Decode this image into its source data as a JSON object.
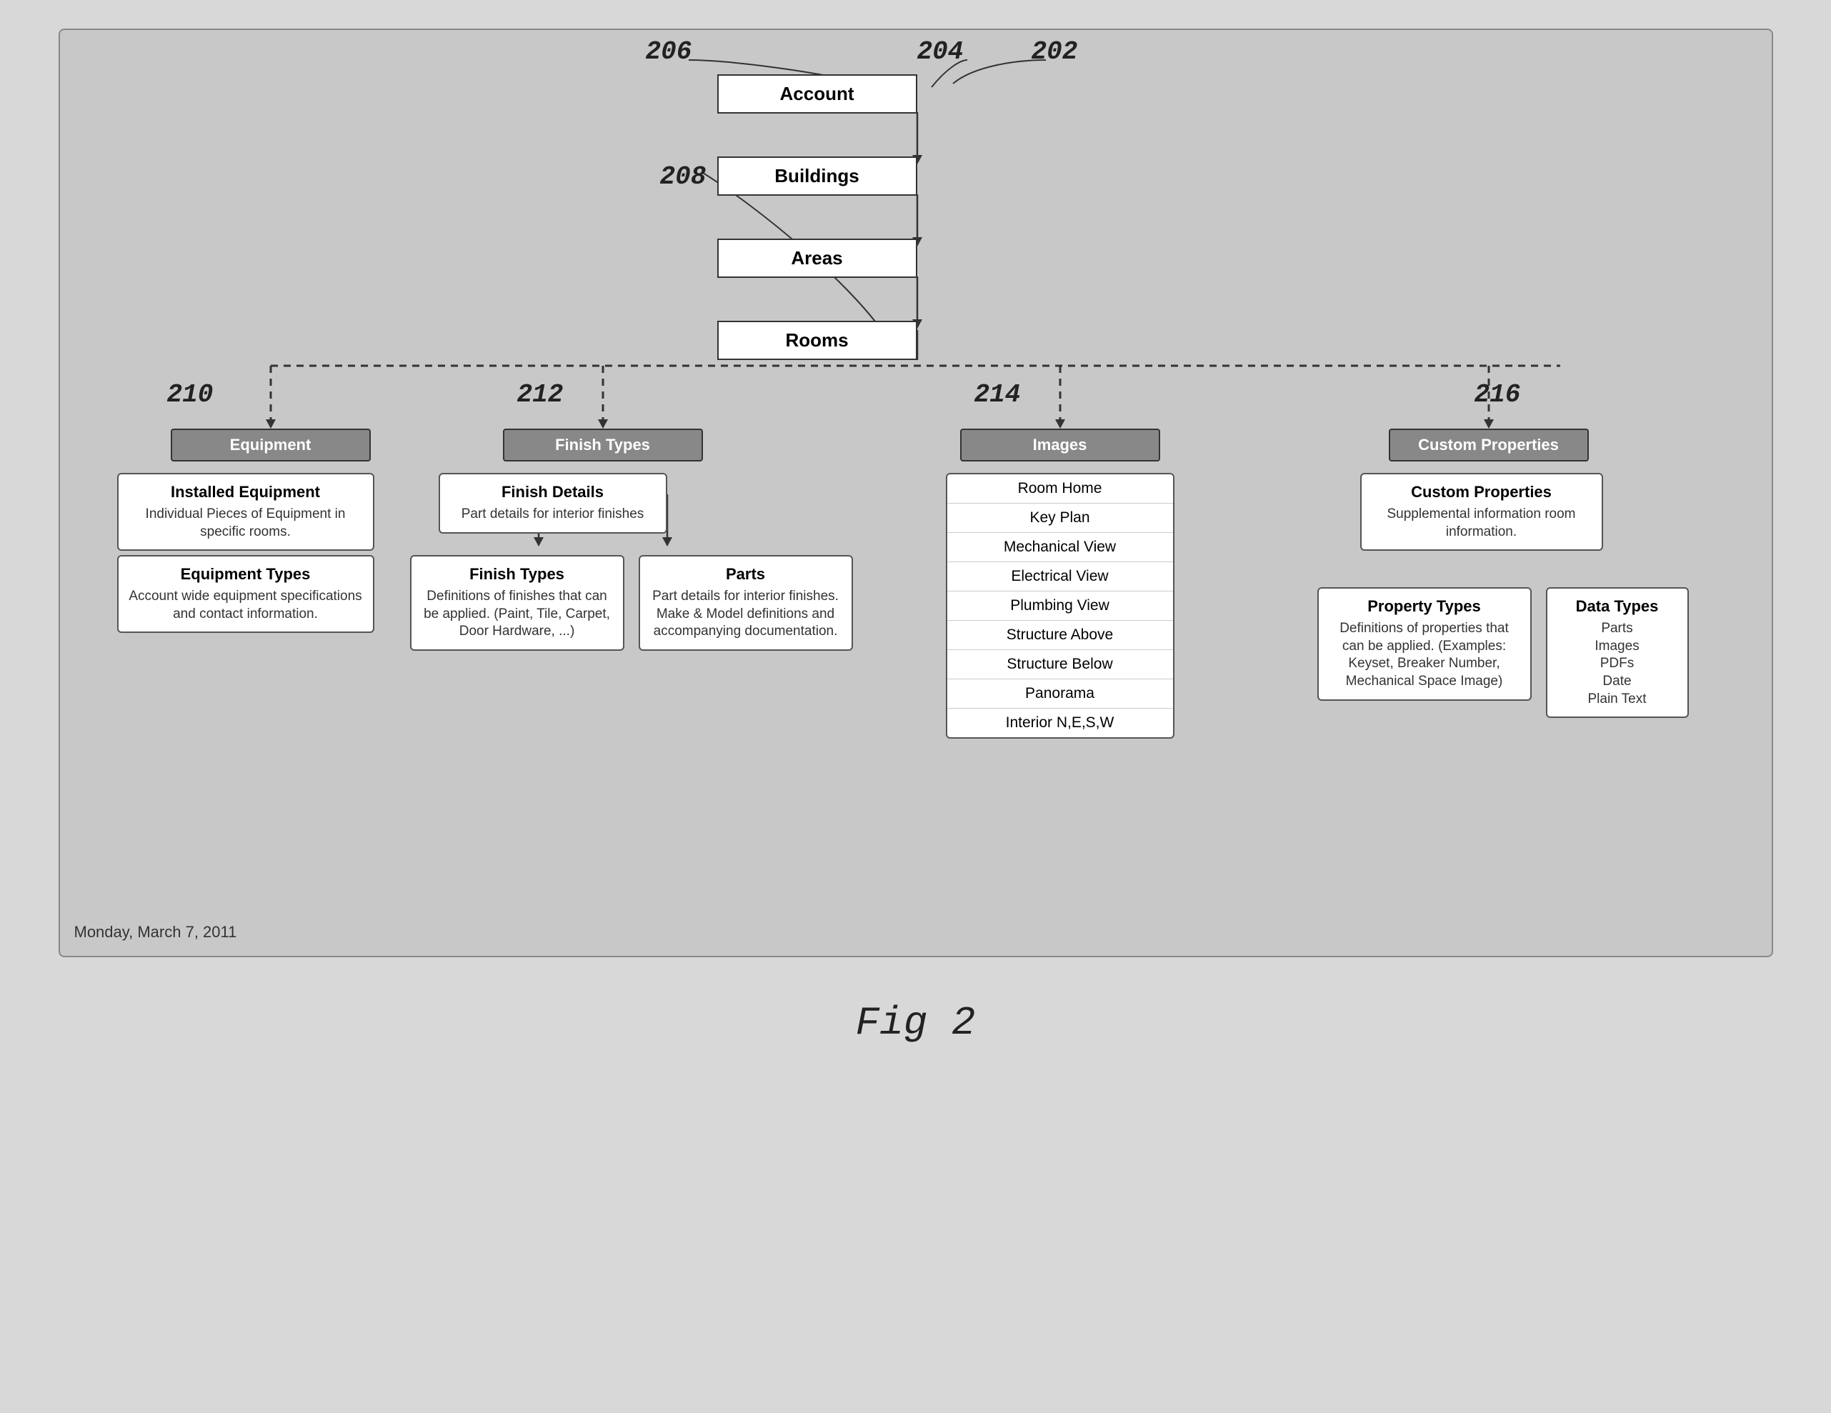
{
  "diagram": {
    "title": "Fig 2",
    "date": "Monday, March 7, 2011",
    "ref_numbers": {
      "r202": "202",
      "r204": "204",
      "r206": "206",
      "r208": "208",
      "r210": "210",
      "r212": "212",
      "r214": "214",
      "r216": "216"
    },
    "hierarchy": {
      "account": "Account",
      "buildings": "Buildings",
      "areas": "Areas",
      "rooms": "Rooms"
    },
    "branches": {
      "equipment": "Equipment",
      "finish_types": "Finish Types",
      "images": "Images",
      "custom_properties": "Custom Properties"
    },
    "equipment_sub": {
      "installed_title": "Installed Equipment",
      "installed_text": "Individual Pieces of Equipment in specific rooms.",
      "types_title": "Equipment Types",
      "types_text": "Account wide equipment specifications and contact information."
    },
    "finish_sub": {
      "details_title": "Finish Details",
      "details_text": "Part details for interior finishes",
      "types_title": "Finish Types",
      "types_text": "Definitions of finishes that can be applied. (Paint, Tile, Carpet, Door Hardware, ...)",
      "parts_title": "Parts",
      "parts_text": "Part details for interior finishes. Make & Model definitions and accompanying documentation."
    },
    "images_list": [
      "Room Home",
      "Key Plan",
      "Mechanical View",
      "Electrical View",
      "Plumbing View",
      "Structure Above",
      "Structure Below",
      "Panorama",
      "Interior N,E,S,W"
    ],
    "custom_sub": {
      "main_title": "Custom Properties",
      "main_text": "Supplemental information room information.",
      "prop_title": "Property Types",
      "prop_text": "Definitions of properties that can be applied. (Examples: Keyset, Breaker Number, Mechanical Space Image)",
      "data_title": "Data Types",
      "data_list": [
        "Parts",
        "Images",
        "PDFs",
        "Date",
        "Plain Text"
      ]
    }
  }
}
